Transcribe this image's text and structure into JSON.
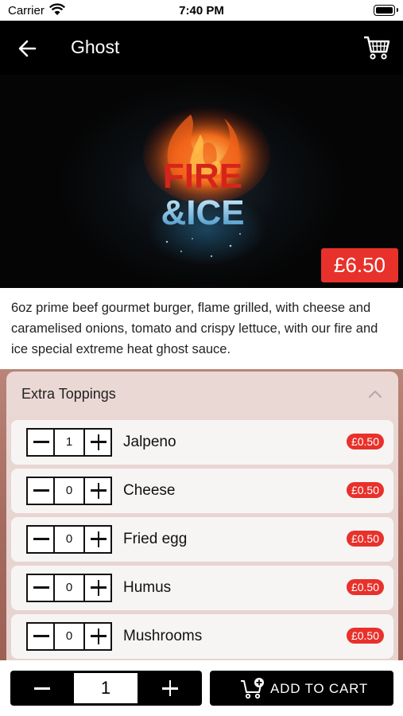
{
  "status_bar": {
    "carrier": "Carrier",
    "time": "7:40 PM"
  },
  "nav": {
    "title": "Ghost",
    "back_icon": "arrow-left-icon",
    "cart_icon": "cart-icon"
  },
  "product": {
    "image_text_top": "FIRE",
    "image_text_bottom": "&ICE",
    "price": "£6.50",
    "description": "6oz prime beef gourmet burger, flame grilled, with cheese and caramelised onions, tomato and crispy lettuce, with our fire and ice special extreme heat ghost sauce."
  },
  "toppings": {
    "title": "Extra Toppings",
    "expanded": true,
    "items": [
      {
        "name": "Jalpeno",
        "qty": "1",
        "price": "£0.50"
      },
      {
        "name": "Cheese",
        "qty": "0",
        "price": "£0.50"
      },
      {
        "name": "Fried egg",
        "qty": "0",
        "price": "£0.50"
      },
      {
        "name": "Humus",
        "qty": "0",
        "price": "£0.50"
      },
      {
        "name": "Mushrooms",
        "qty": "0",
        "price": "£0.50"
      }
    ]
  },
  "bottom_bar": {
    "quantity": "1",
    "add_to_cart_label": "ADD TO CART"
  },
  "colors": {
    "accent": "#e8312b",
    "nav_bg": "#000000",
    "toppings_bg": "#a66c60"
  }
}
